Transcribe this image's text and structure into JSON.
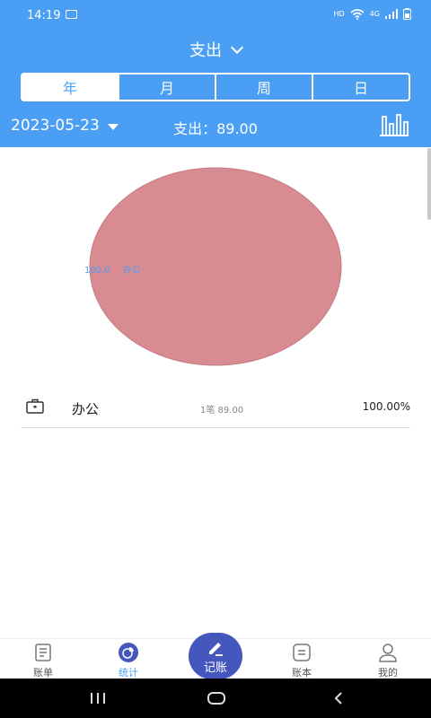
{
  "status_bar": {
    "time": "14:19",
    "network_label": "HD",
    "signal_label": "4G"
  },
  "header": {
    "title": "支出",
    "tabs": [
      {
        "label": "年",
        "active": true
      },
      {
        "label": "月",
        "active": false
      },
      {
        "label": "周",
        "active": false
      },
      {
        "label": "日",
        "active": false
      }
    ],
    "date": "2023-05-23",
    "expense_summary": "支出：89.00"
  },
  "chart_data": {
    "type": "pie",
    "slices": [
      {
        "label": "办公",
        "value": 100.0,
        "color": "#d88c91"
      }
    ],
    "data_labels": [
      "100.0",
      "办公"
    ]
  },
  "categories": [
    {
      "name": "办公",
      "detail": "1笔  89.00",
      "percent": "100.00%",
      "icon": "briefcase-icon"
    }
  ],
  "tabbar": {
    "items": [
      {
        "label": "账单",
        "icon": "bill-icon"
      },
      {
        "label": "统计",
        "icon": "pie-chart-icon",
        "active": true
      },
      {
        "label": "记账",
        "icon": "pencil-icon"
      },
      {
        "label": "账本",
        "icon": "ledger-icon"
      },
      {
        "label": "我的",
        "icon": "person-icon"
      }
    ]
  },
  "colors": {
    "primary": "#4a9ff5",
    "record_button": "#4556bd",
    "pie_slice": "#d88c91"
  }
}
